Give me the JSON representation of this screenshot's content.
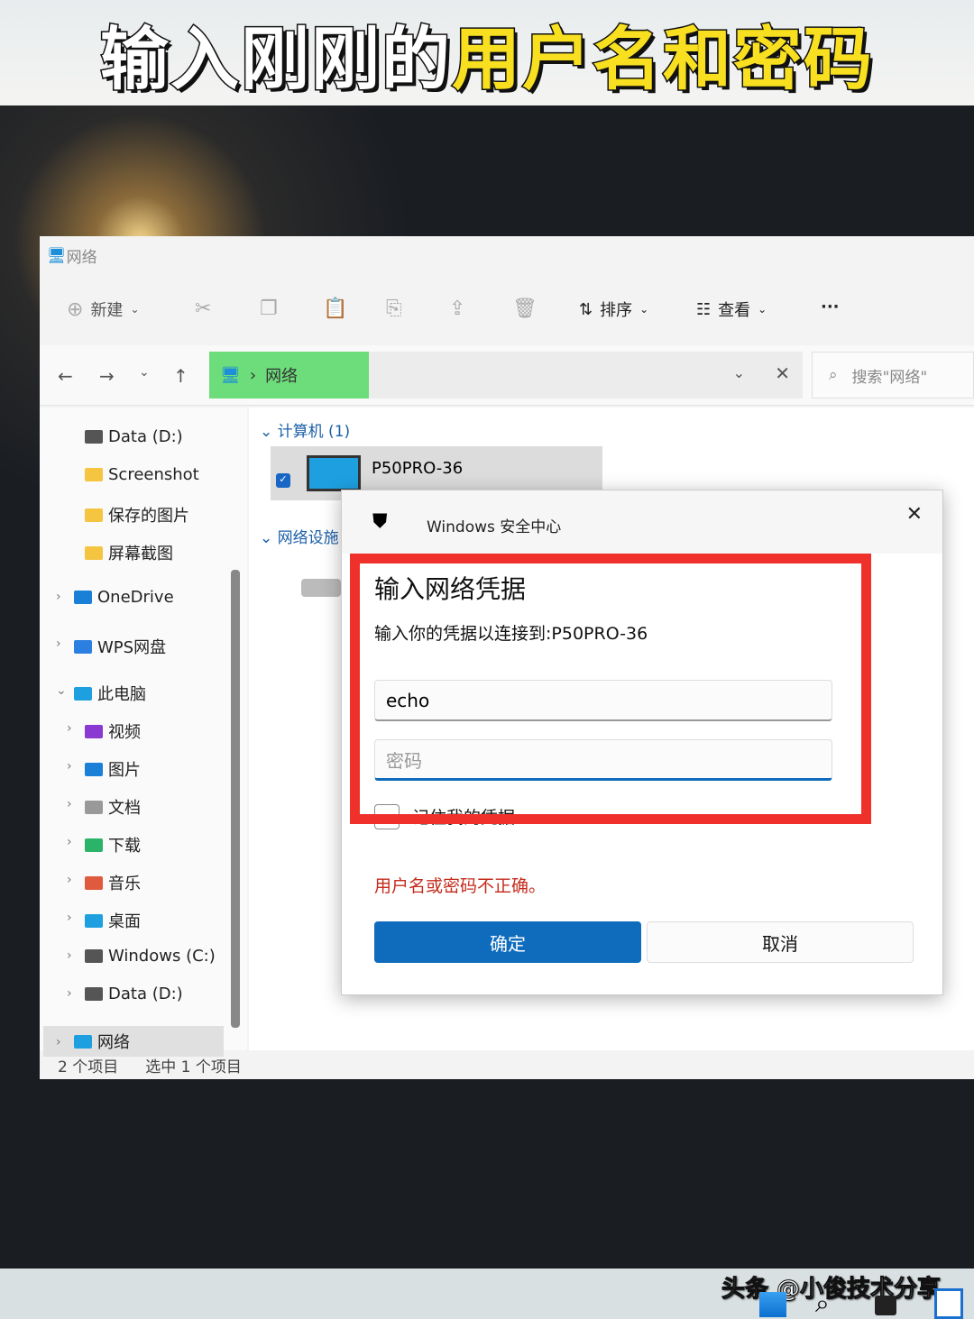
{
  "banner": {
    "white": "输入刚刚的",
    "yellow": "用户名和密码"
  },
  "window": {
    "title": "网络"
  },
  "toolbar": {
    "new": "新建",
    "sort": "排序",
    "view": "查看",
    "more": "···"
  },
  "address": {
    "path": "网络",
    "search_placeholder": "搜索\"网络\""
  },
  "sidebar": {
    "items": [
      "Data (D:)",
      "Screenshot",
      "保存的图片",
      "屏幕截图",
      "OneDrive",
      "WPS网盘",
      "此电脑",
      "视频",
      "图片",
      "文档",
      "下载",
      "音乐",
      "桌面",
      "Windows (C:)",
      "Data (D:)",
      "网络"
    ]
  },
  "content": {
    "group1": "计算机 (1)",
    "computer": "P50PRO-36",
    "group2": "网络设施"
  },
  "status": {
    "count": "2 个项目",
    "selected": "选中 1 个项目"
  },
  "dialog": {
    "app": "Windows 安全中心",
    "heading": "输入网络凭据",
    "subtitle": "输入你的凭据以连接到:P50PRO-36",
    "username": "echo",
    "password_placeholder": "密码",
    "remember": "记住我的凭据",
    "error": "用户名或密码不正确。",
    "ok": "确定",
    "cancel": "取消"
  },
  "watermark": "头条 @小俊技术分享",
  "colors": {
    "accent": "#0f6cbd",
    "error": "#c42b1c",
    "highlight": "#f0302a"
  }
}
